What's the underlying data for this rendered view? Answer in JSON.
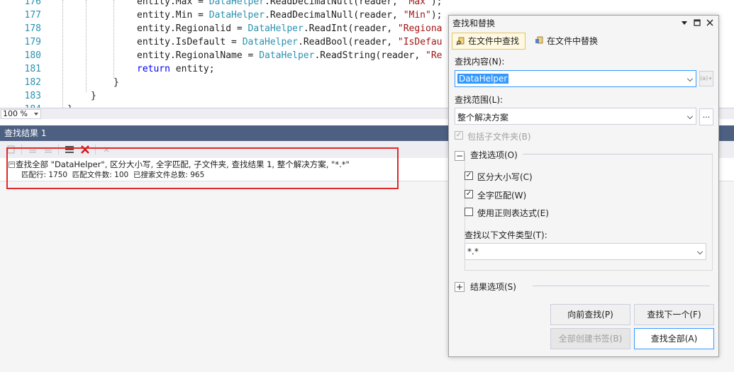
{
  "editor": {
    "lines": [
      {
        "num": "176",
        "parts": [
          {
            "t": "entity.Max = ",
            "c": ""
          },
          {
            "t": "DataHelper",
            "c": "cls"
          },
          {
            "t": ".ReadDecimalNull(reader, ",
            "c": ""
          },
          {
            "t": "\"Max\"",
            "c": "str"
          },
          {
            "t": ");",
            "c": ""
          }
        ]
      },
      {
        "num": "177",
        "parts": [
          {
            "t": "entity.Min = ",
            "c": ""
          },
          {
            "t": "DataHelper",
            "c": "cls"
          },
          {
            "t": ".ReadDecimalNull(reader, ",
            "c": ""
          },
          {
            "t": "\"Min\"",
            "c": "str"
          },
          {
            "t": ");",
            "c": ""
          }
        ]
      },
      {
        "num": "178",
        "parts": [
          {
            "t": "entity.Regionalid = ",
            "c": ""
          },
          {
            "t": "DataHelper",
            "c": "cls"
          },
          {
            "t": ".ReadInt(reader, ",
            "c": ""
          },
          {
            "t": "\"Regiona",
            "c": "str"
          }
        ]
      },
      {
        "num": "179",
        "parts": [
          {
            "t": "entity.IsDefault = ",
            "c": ""
          },
          {
            "t": "DataHelper",
            "c": "cls"
          },
          {
            "t": ".ReadBool(reader, ",
            "c": ""
          },
          {
            "t": "\"IsDefau",
            "c": "str"
          }
        ]
      },
      {
        "num": "180",
        "parts": [
          {
            "t": "entity.RegionalName = ",
            "c": ""
          },
          {
            "t": "DataHelper",
            "c": "cls"
          },
          {
            "t": ".ReadString(reader, ",
            "c": ""
          },
          {
            "t": "\"Re",
            "c": "str"
          }
        ]
      },
      {
        "num": "181",
        "parts": [
          {
            "t": "return",
            "c": "kw"
          },
          {
            "t": " entity;",
            "c": ""
          }
        ]
      },
      {
        "num": "182",
        "parts": [
          {
            "t": "}",
            "c": ""
          }
        ]
      },
      {
        "num": "183",
        "parts": [
          {
            "t": "}",
            "c": ""
          }
        ]
      },
      {
        "num": "184",
        "parts": [
          {
            "t": "}",
            "c": ""
          }
        ]
      }
    ],
    "zoom": "100 %"
  },
  "results": {
    "title": "查找结果 1",
    "line1": "查找全部 \"DataHelper\", 区分大小写, 全字匹配, 子文件夹, 查找结果 1, 整个解决方案, \"*.*\"",
    "line2": "匹配行: 1750  匹配文件数: 100  已搜索文件总数: 965",
    "collapse_glyph": "−"
  },
  "dialog": {
    "title": "查找和替换",
    "tab_find": "在文件中查找",
    "tab_replace": "在文件中替换",
    "find_label": "查找内容(N):",
    "find_value": "DataHelper",
    "scope_label": "查找范围(L):",
    "scope_value": "整个解决方案",
    "browse_label": "...",
    "include_subfolders": "包括子文件夹(B)",
    "find_options_label": "查找选项(O)",
    "match_case": "区分大小写(C)",
    "whole_word": "全字匹配(W)",
    "use_regex": "使用正则表达式(E)",
    "filetypes_label": "查找以下文件类型(T):",
    "filetypes_value": "*.*",
    "result_options_label": "结果选项(S)",
    "btn_find_prev": "向前查找(P)",
    "btn_find_next": "查找下一个(F)",
    "btn_bookmark_all": "全部创建书签(B)",
    "btn_find_all": "查找全部(A)",
    "check_glyph": "✓",
    "minus_glyph": "−",
    "plus_glyph": "+",
    "regex_icon_text": "(a)+"
  },
  "colors": {
    "accent": "#3399ff",
    "results_title_bg": "#4d6082",
    "highlight_border": "#e0282a",
    "type_color": "#2b91af",
    "string_color": "#a31515",
    "keyword_color": "#0000ff"
  }
}
